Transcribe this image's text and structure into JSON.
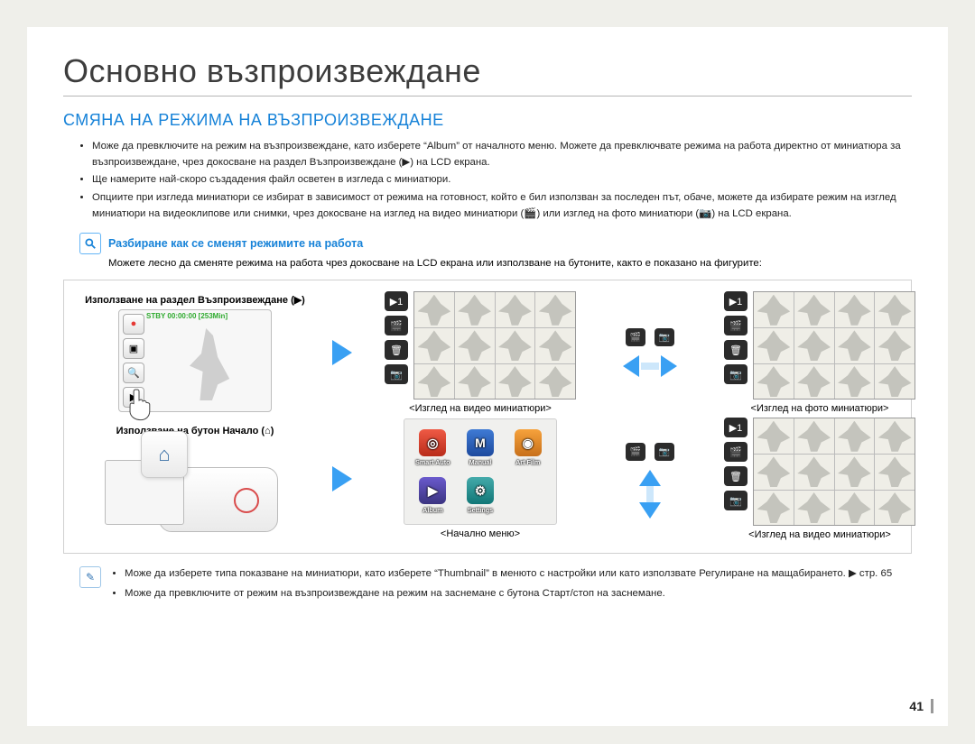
{
  "page": {
    "title": "Основно възпроизвеждане",
    "section": "СМЯНА НА РЕЖИМА НА ВЪЗПРОИЗВЕЖДАНЕ",
    "bullets": [
      "Може да превключите на режим на възпроизвеждане, като изберете “Album” от началното меню. Можете да превключвате режима на работа директно от миниатюра за възпроизвеждане, чрез докосване на раздел Възпроизвеждане (▶) на LCD екрана.",
      "Ще намерите най-скоро създадения файл осветен в изгледа с миниатюри.",
      "Опциите при изгледа миниатюри се избират в зависимост от режима на готовност, който е бил използван за последен път, обаче, можете да избирате режим на изглед миниатюри на видеоклипове или снимки, чрез докосване на изглед на видео миниатюри (🎬) или изглед на фото миниатюри (📷) на LCD екрана."
    ],
    "subhead": {
      "title": "Разбиране как се сменят режимите на работа",
      "desc": "Можете лесно да сменяте режима на работа чрез докосване на LCD екрана или използване на бутоните, както е показано на фигурите:"
    },
    "labels": {
      "play_section": "Използване на раздел Възпроизвеждане (▶)",
      "home_button": "Използване на бутон Начало (⌂)",
      "video_thumb_caption": "<Изглед на видео миниатюри>",
      "photo_thumb_caption": "<Изглед на фото миниатюри>",
      "home_menu_caption": "<Начално меню>",
      "stby": "STBY 00:00:00 [253Min]"
    },
    "home_items": [
      "Smart Auto",
      "Manual",
      "Art Film",
      "Album",
      "Settings"
    ],
    "notes": [
      "Може да изберете типа показване на миниатюри, като изберете “Thumbnail” в менюто с настройки или като използвате Регулиране на мащабирането. ▶ стр. 65",
      "Може да превключите от режим на възпроизвеждане на режим на заснемане с бутона Старт/стоп на заснемане."
    ],
    "page_number": "41"
  }
}
